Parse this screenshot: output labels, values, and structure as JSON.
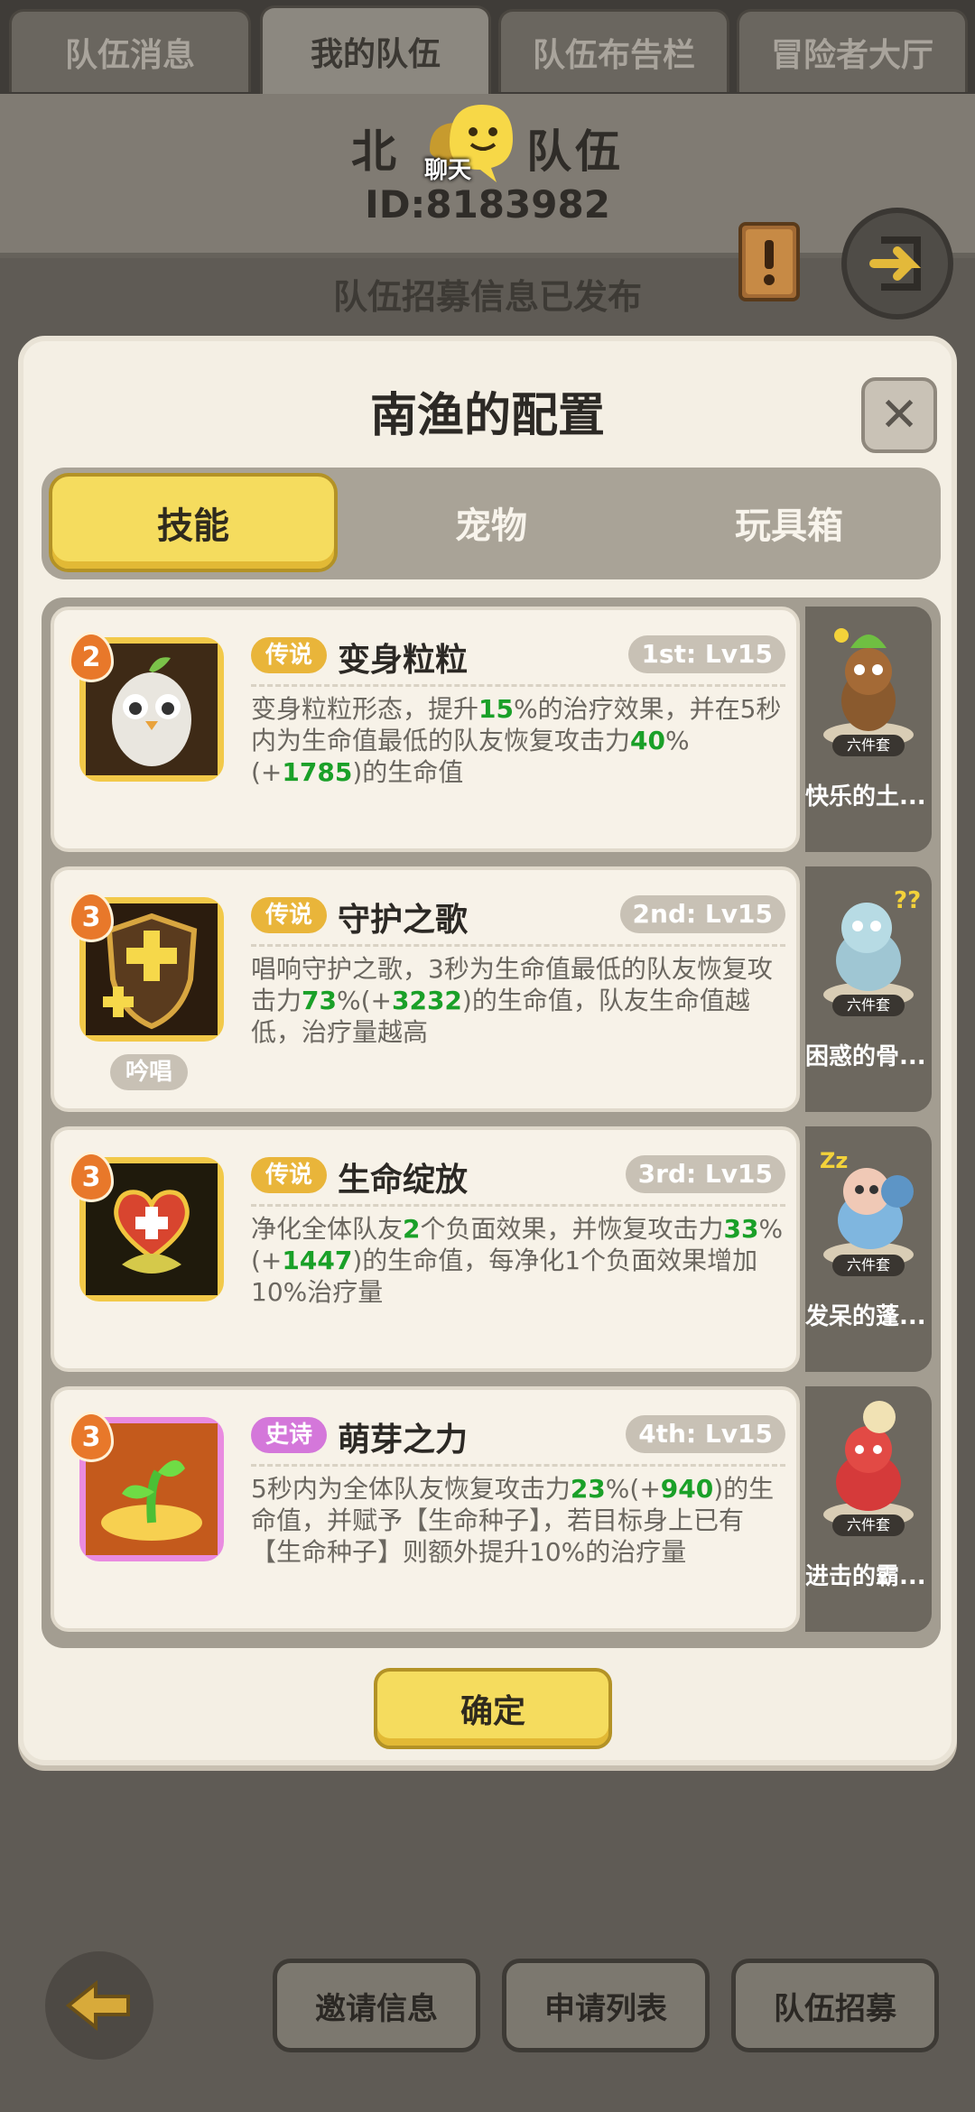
{
  "top_tabs": [
    "队伍消息",
    "我的队伍",
    "队伍布告栏",
    "冒险者大厅"
  ],
  "team": {
    "name_prefix": "北",
    "name_suffix": "队伍",
    "id": "ID:8183982",
    "chat_label": "聊天",
    "recruit_status": "队伍招募信息已发布"
  },
  "modal": {
    "title": "南渔的配置",
    "close_label": "✕",
    "tabs": [
      "技能",
      "宠物",
      "玩具箱"
    ],
    "active_tab": 0,
    "confirm_label": "确定"
  },
  "skills": [
    {
      "level": "2",
      "rarity": "传说",
      "name": "变身粒粒",
      "slot": "1st: Lv15",
      "desc_parts": [
        [
          "变身粒粒形态，提升",
          false
        ],
        [
          "15",
          true
        ],
        [
          "%的治疗效果，并在5秒内为生命值最低的队友恢复攻击力",
          false
        ],
        [
          "40",
          true
        ],
        [
          "%(+",
          false
        ],
        [
          "1785",
          true
        ],
        [
          ")的生命值",
          false
        ]
      ],
      "pet_name": "快乐的土...",
      "pet_set": "六件套"
    },
    {
      "level": "3",
      "rarity": "传说",
      "name": "守护之歌",
      "slot": "2nd: Lv15",
      "chant": "吟唱",
      "desc_parts": [
        [
          "唱响守护之歌，3秒为生命值最低的队友恢复攻击力",
          false
        ],
        [
          "73",
          true
        ],
        [
          "%(+",
          false
        ],
        [
          "3232",
          true
        ],
        [
          ")的生命值，队友生命值越低，治疗量越高",
          false
        ]
      ],
      "pet_name": "困惑的骨...",
      "pet_set": "六件套"
    },
    {
      "level": "3",
      "rarity": "传说",
      "name": "生命绽放",
      "slot": "3rd: Lv15",
      "desc_parts": [
        [
          "净化全体队友",
          false
        ],
        [
          "2",
          true
        ],
        [
          "个负面效果，并恢复攻击力",
          false
        ],
        [
          "33",
          true
        ],
        [
          "%(+",
          false
        ],
        [
          "1447",
          true
        ],
        [
          ")的生命值，每净化1个负面效果增加10%治疗量",
          false
        ]
      ],
      "pet_name": "发呆的蓬...",
      "pet_set": "六件套"
    },
    {
      "level": "3",
      "rarity": "史诗",
      "name": "萌芽之力",
      "slot": "4th: Lv15",
      "desc_parts": [
        [
          "5秒内为全体队友恢复攻击力",
          false
        ],
        [
          "23",
          true
        ],
        [
          "%(+",
          false
        ],
        [
          "940",
          true
        ],
        [
          ")的生命值，并赋予【生命种子】，若目标身上已有【生命种子】则额外提升10%的治疗量",
          false
        ]
      ],
      "pet_name": "进击的霸...",
      "pet_set": "六件套"
    }
  ],
  "bottom_buttons": [
    "邀请信息",
    "申请列表",
    "队伍招募"
  ]
}
